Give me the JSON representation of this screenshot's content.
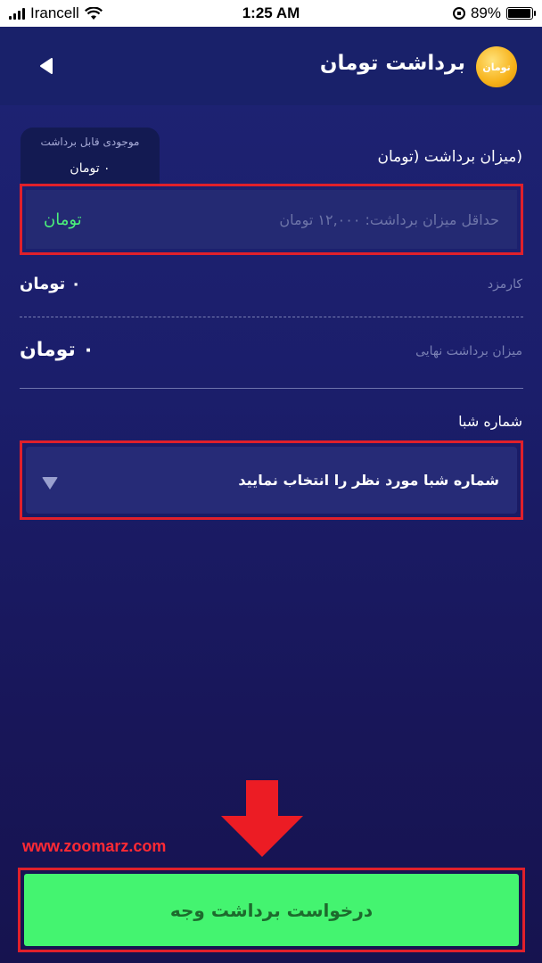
{
  "status_bar": {
    "carrier": "Irancell",
    "time": "1:25 AM",
    "battery": "89%",
    "battery_level": 0.89
  },
  "header": {
    "title": "برداشت تومان",
    "coin_label": "تومان",
    "back_icon": "back-arrow-icon"
  },
  "balance": {
    "label": "موجودی قابل برداشت",
    "value": "۰ تومان"
  },
  "amount": {
    "label": "(میزان برداشت (تومان",
    "placeholder": "حداقل میزان برداشت: ۱۲,۰۰۰ تومان",
    "currency": "تومان"
  },
  "fee": {
    "label": "کارمزد",
    "value": "۰ تومان"
  },
  "final": {
    "label": "میزان برداشت نهایی",
    "value": "۰ تومان"
  },
  "sheba": {
    "label": "شماره شبا",
    "select_text": "شماره شبا مورد نظر را انتخاب نمایید"
  },
  "watermark": "www.zoomarz.com",
  "submit": {
    "label": "درخواست برداشت وجه"
  },
  "colors": {
    "background": "#1b1e6b",
    "accent_green": "#44f470",
    "highlight_red": "#e0202b"
  }
}
